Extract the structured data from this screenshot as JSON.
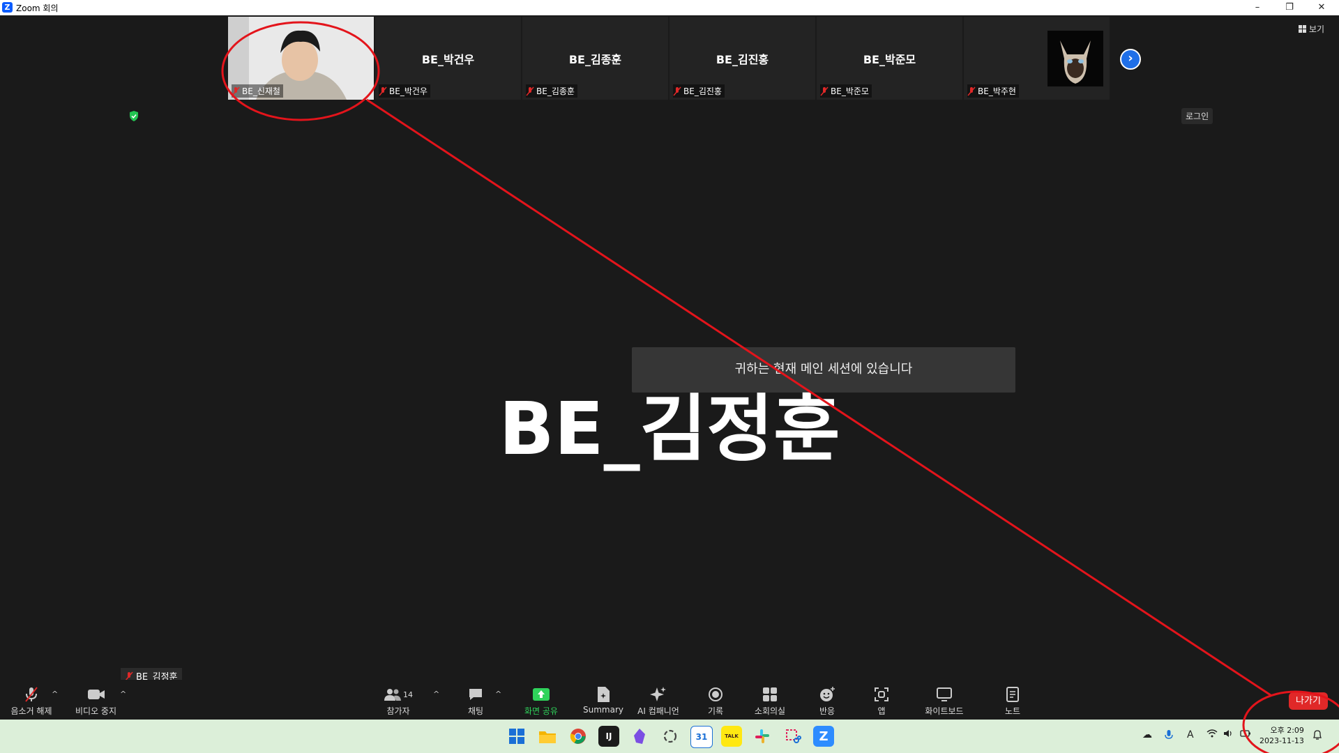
{
  "window": {
    "title": "Zoom 회의",
    "minimize": "–",
    "maximize": "❐",
    "close": "✕"
  },
  "gallery": {
    "tiles": [
      {
        "name": "",
        "label": "BE_신재철",
        "has_video": true
      },
      {
        "name": "BE_박건우",
        "label": "BE_박건우"
      },
      {
        "name": "BE_김종훈",
        "label": "BE_김종훈"
      },
      {
        "name": "BE_김진홍",
        "label": "BE_김진홍"
      },
      {
        "name": "BE_박준모",
        "label": "BE_박준모"
      },
      {
        "name": "",
        "label": "BE_박주현",
        "has_cat": true
      }
    ],
    "next_icon": "›"
  },
  "view_button": "보기",
  "login_button": "로그인",
  "speaker": {
    "name": "BE_김정훈",
    "label": "BE_김정훈"
  },
  "toast": "귀하는 현재 메인 세션에 있습니다",
  "toolbar": {
    "unmute": "음소거 해제",
    "stop_video": "비디오 중지",
    "participants": "참가자",
    "participants_count": "14",
    "chat": "채팅",
    "share_screen": "화면 공유",
    "summary": "Summary",
    "ai_companion": "AI 컴패니언",
    "record": "기록",
    "breakout": "소회의실",
    "reactions": "반응",
    "apps": "앱",
    "whiteboard": "화이트보드",
    "notes": "노트",
    "caret": "^"
  },
  "leave_button": "나가기",
  "taskbar": {
    "clock_time": "오후 2:09",
    "clock_date": "2023-11-13",
    "calendar_day": "31",
    "kakao_label": "TALK",
    "ime": "A"
  },
  "colors": {
    "annotation": "#e3141b",
    "leave": "#e02828",
    "share": "#2fd35b",
    "accent": "#1f6fe8"
  }
}
